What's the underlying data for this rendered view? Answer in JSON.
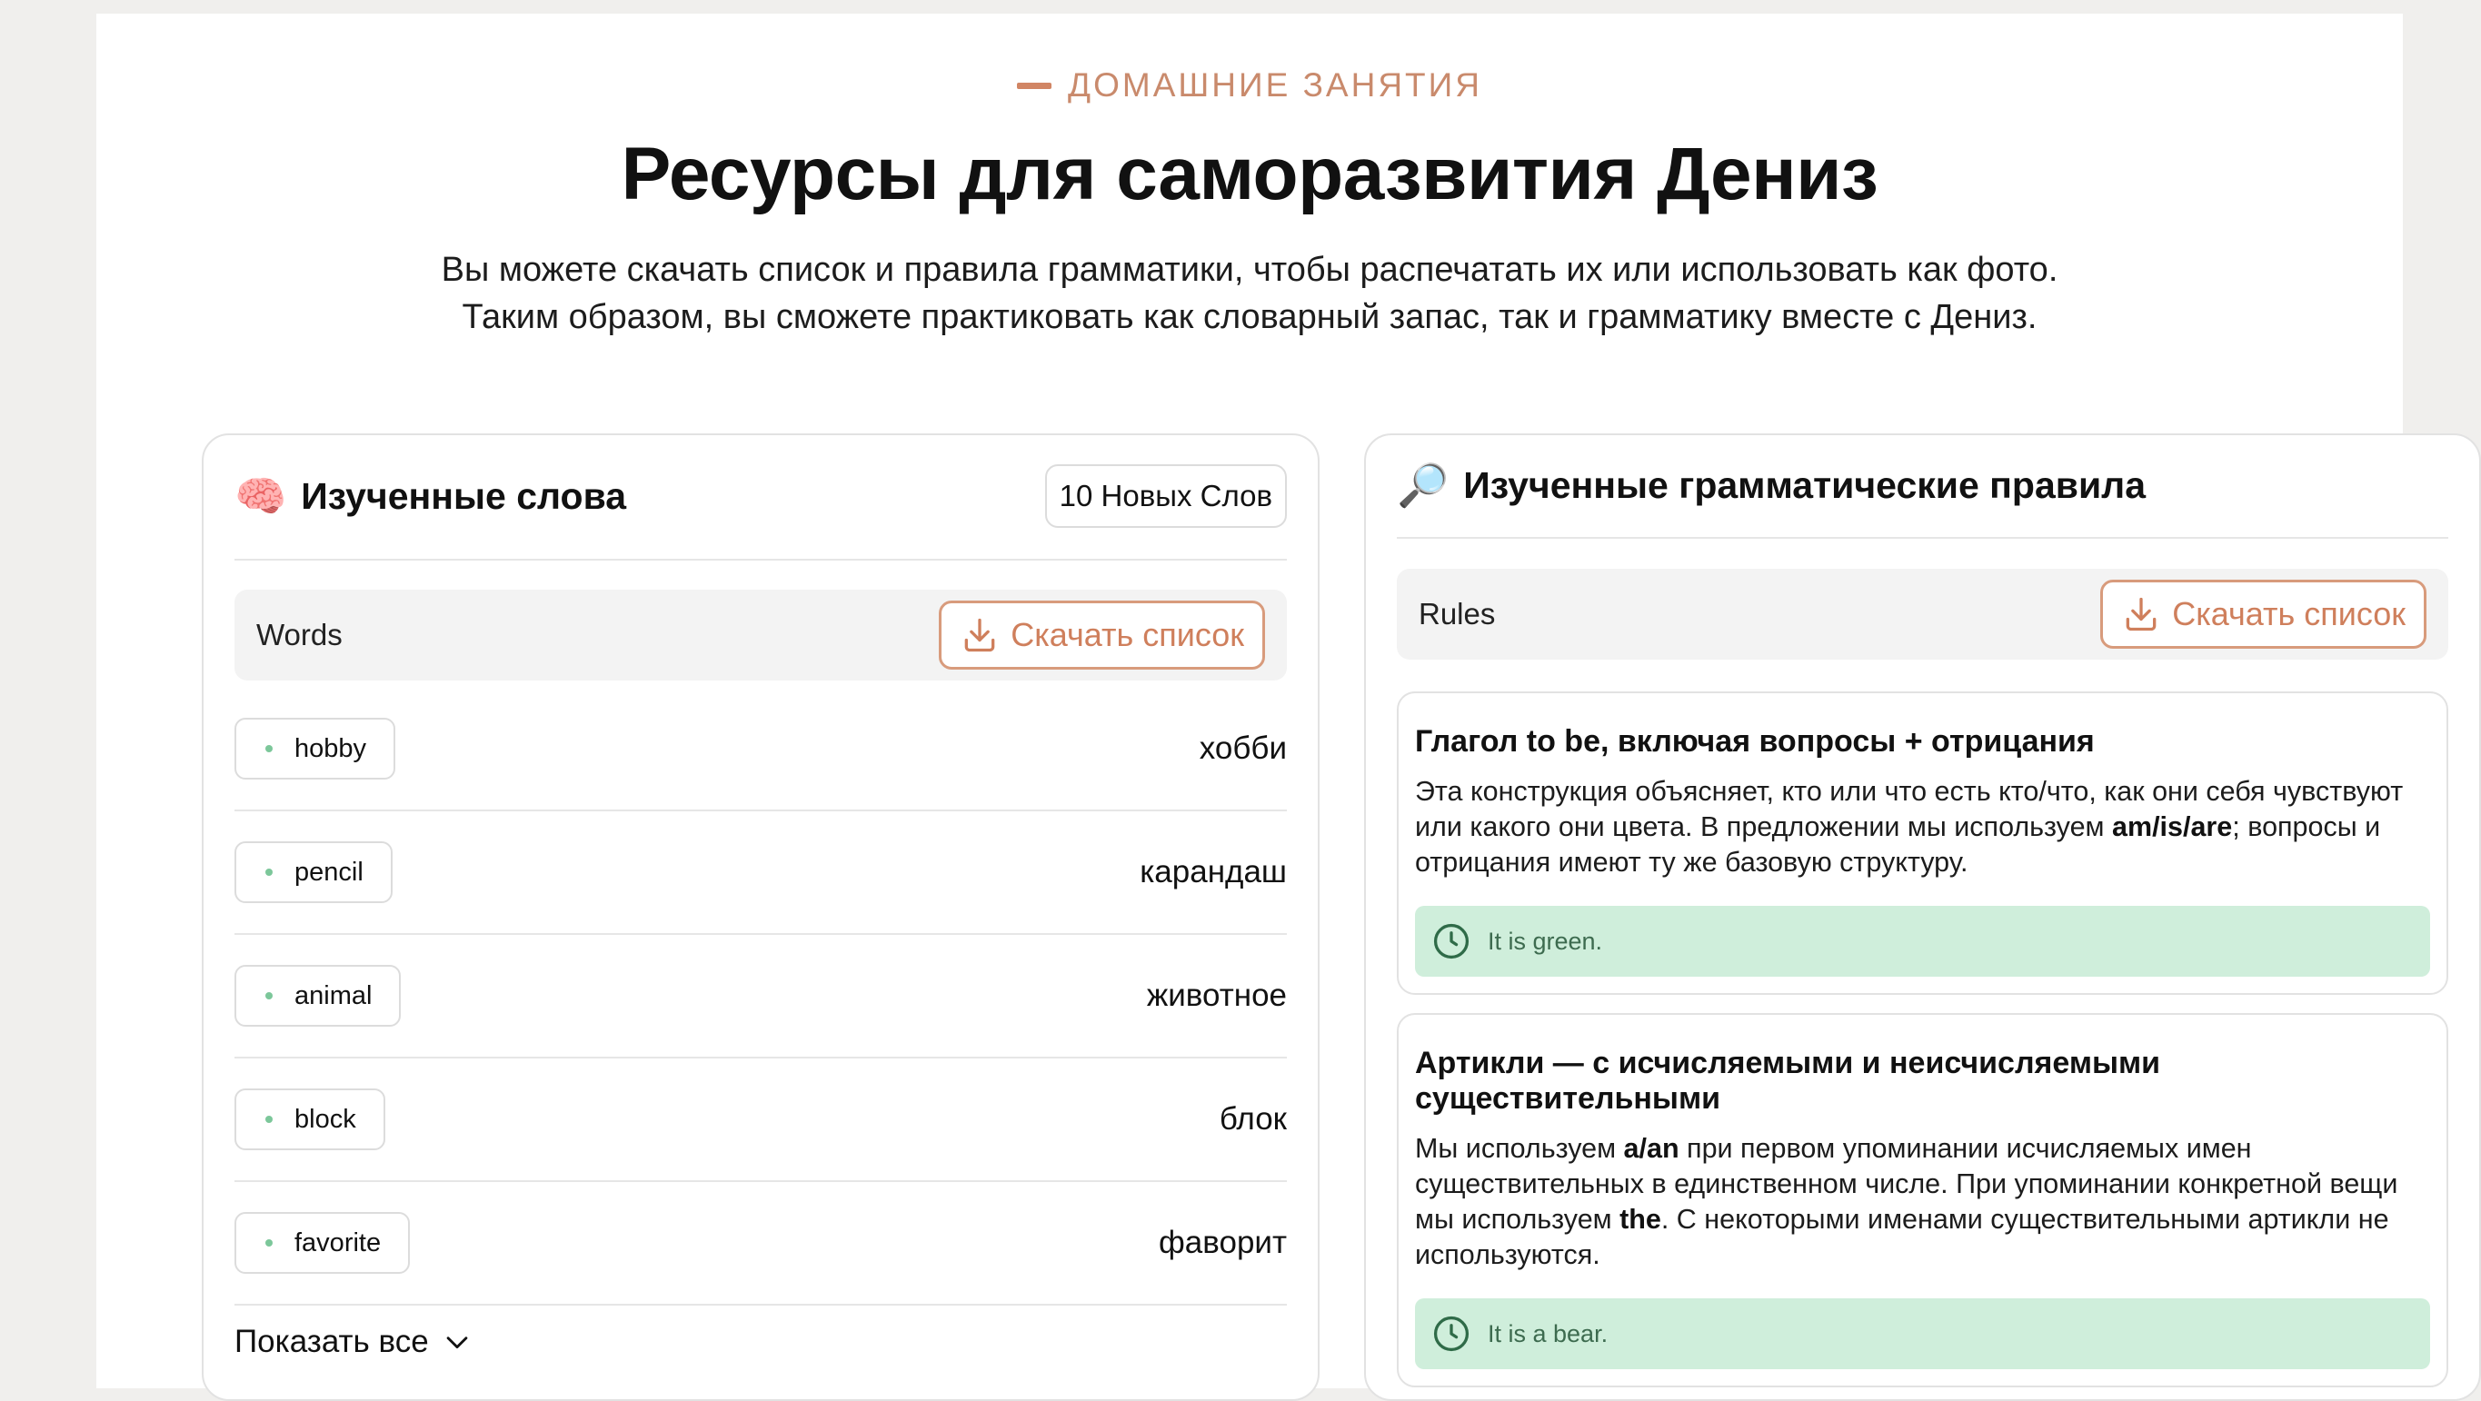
{
  "header": {
    "eyebrow": "ДОМАШНИЕ ЗАНЯТИЯ",
    "title": "Ресурсы для саморазвития Дениз",
    "subtitle_line1": "Вы можете скачать список и правила грамматики, чтобы распечатать их или использовать как фото.",
    "subtitle_line2": "Таким образом, вы сможете практиковать как словарный запас, так и грамматику вместе с Дениз."
  },
  "words_card": {
    "icon": "🧠",
    "icon_name": "brain-icon",
    "title": "Изученные слова",
    "badge": "10 Новых Слов",
    "toolbar_label": "Words",
    "download_label": "Скачать список",
    "words": [
      {
        "word": "hobby",
        "translation": "хобби"
      },
      {
        "word": "pencil",
        "translation": "карандаш"
      },
      {
        "word": "animal",
        "translation": "животное"
      },
      {
        "word": "block",
        "translation": "блок"
      },
      {
        "word": "favorite",
        "translation": "фаворит"
      }
    ],
    "show_all": "Показать все"
  },
  "grammar_card": {
    "icon": "🔎",
    "icon_name": "magnifier-icon",
    "title": "Изученные грамматические правила",
    "toolbar_label": "Rules",
    "download_label": "Скачать список",
    "rules": [
      {
        "title": "Глагол to be, включая вопросы + отрицания",
        "text_before": "Эта конструкция объясняет, кто или что есть кто/что, как они себя чувствуют или какого они цвета. В предложении мы используем ",
        "bold1": "am/is/are",
        "text_after": "; вопросы и отрицания имеют ту же базовую структуру.",
        "example": "It is green."
      },
      {
        "title": "Артикли — с исчисляемыми и неисчисляемыми существительными",
        "text_before": "Мы используем ",
        "bold1": "a/an",
        "text_middle": " при первом упоминании исчисляемых имен существительных в единственном числе. При упоминании конкретной вещи мы используем ",
        "bold2": "the",
        "text_after": ". С некоторыми именами существительными артикли не используются.",
        "example": "It is a bear."
      }
    ]
  },
  "colors": {
    "accent": "#d18564",
    "example_bg": "#cfeedb",
    "page_bg": "#f0efed"
  }
}
